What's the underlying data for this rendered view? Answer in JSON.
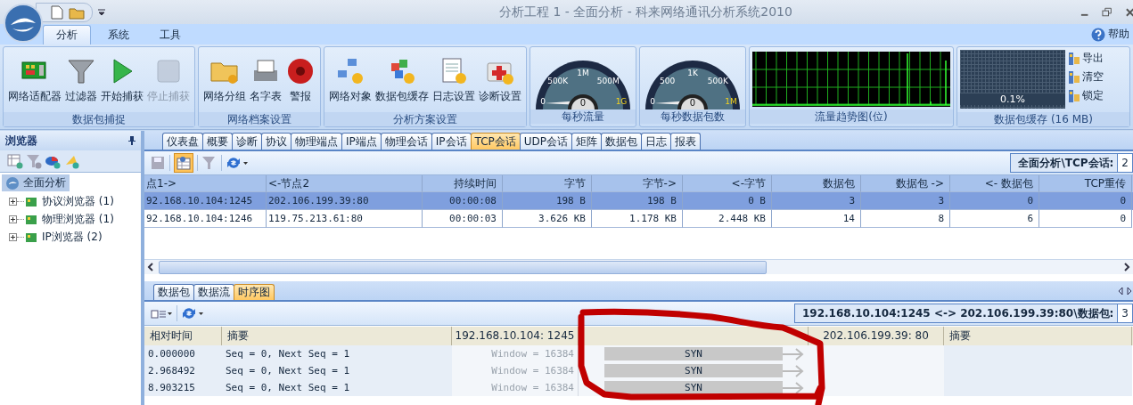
{
  "window": {
    "title": "分析工程 1 - 全面分析 - 科来网络通讯分析系统2010",
    "help": "帮助"
  },
  "ribbon_tabs": [
    {
      "label": "分析",
      "selected": true
    },
    {
      "label": "系统",
      "selected": false
    },
    {
      "label": "工具",
      "selected": false
    }
  ],
  "ribbon_groups": [
    {
      "label": "数据包捕捉",
      "buttons": [
        {
          "label": "网络适配器",
          "kind": "adapter",
          "disabled": false
        },
        {
          "label": "过滤器",
          "kind": "filter",
          "disabled": false
        },
        {
          "label": "开始捕获",
          "kind": "play",
          "disabled": false
        },
        {
          "label": "停止捕获",
          "kind": "stop",
          "disabled": true
        }
      ]
    },
    {
      "label": "网络档案设置",
      "buttons": [
        {
          "label": "网络分组",
          "kind": "folder",
          "disabled": false
        },
        {
          "label": "名字表",
          "kind": "cards",
          "disabled": false
        },
        {
          "label": "警报",
          "kind": "alarm",
          "disabled": false
        }
      ]
    },
    {
      "label": "分析方案设置",
      "buttons": [
        {
          "label": "网络对象",
          "kind": "network",
          "disabled": false
        },
        {
          "label": "数据包缓存",
          "kind": "cubes",
          "disabled": false
        },
        {
          "label": "日志设置",
          "kind": "log",
          "disabled": false
        },
        {
          "label": "诊断设置",
          "kind": "medkit",
          "disabled": false
        }
      ]
    }
  ],
  "gauges": [
    {
      "label": "每秒流量",
      "ticks": [
        "0",
        "500K",
        "1M",
        "500M",
        "1G"
      ],
      "reading": "0"
    },
    {
      "label": "每秒数据包数",
      "ticks": [
        "0",
        "500",
        "1K",
        "500K",
        "1M"
      ],
      "reading": "0"
    }
  ],
  "trend": {
    "label": "流量趋势图(位)"
  },
  "buffer": {
    "label": "数据包缓存 (16 MB)",
    "reading": "0.1%",
    "actions": [
      "导出",
      "清空",
      "锁定"
    ]
  },
  "sidebar": {
    "title": "浏览器",
    "tree": [
      {
        "label": "全面分析",
        "selected": true,
        "children": [
          {
            "label": "协议浏览器",
            "count": "(1)",
            "expanded": false
          },
          {
            "label": "物理浏览器",
            "count": "(1)",
            "expanded": false
          },
          {
            "label": "IP浏览器",
            "count": "(2)",
            "expanded": false
          }
        ]
      }
    ]
  },
  "tabs": [
    {
      "label": "仪表盘",
      "selected": false
    },
    {
      "label": "概要",
      "selected": false
    },
    {
      "label": "诊断",
      "selected": false
    },
    {
      "label": "协议",
      "selected": false
    },
    {
      "label": "物理端点",
      "selected": false
    },
    {
      "label": "IP端点",
      "selected": false
    },
    {
      "label": "物理会话",
      "selected": false
    },
    {
      "label": "IP会话",
      "selected": false
    },
    {
      "label": "TCP会话",
      "selected": true
    },
    {
      "label": "UDP会话",
      "selected": false
    },
    {
      "label": "矩阵",
      "selected": false
    },
    {
      "label": "数据包",
      "selected": false
    },
    {
      "label": "日志",
      "selected": false
    },
    {
      "label": "报表",
      "selected": false
    }
  ],
  "path": {
    "label": "全面分析\\TCP会话:",
    "value": "2"
  },
  "table": {
    "columns": [
      "点1->",
      "<-节点2",
      "持续时间",
      "字节",
      "字节->",
      "<-字节",
      "数据包",
      "数据包 ->",
      "<- 数据包",
      "TCP重传"
    ],
    "rows": [
      {
        "selected": true,
        "cells": [
          "92.168.10.104:1245",
          "202.106.199.39:80",
          "00:00:08",
          "198  B",
          "198  B",
          "0  B",
          "3",
          "3",
          "0",
          "0"
        ]
      },
      {
        "selected": false,
        "cells": [
          "92.168.10.104:1246",
          "119.75.213.61:80",
          "00:00:03",
          "3.626 KB",
          "1.178 KB",
          "2.448 KB",
          "14",
          "8",
          "6",
          "0"
        ]
      }
    ]
  },
  "bottom_tabs": [
    {
      "label": "数据包",
      "selected": false
    },
    {
      "label": "数据流",
      "selected": false
    },
    {
      "label": "时序图",
      "selected": true
    }
  ],
  "sequence": {
    "path": {
      "label": "192.168.10.104:1245 <-> 202.106.199.39:80\\数据包:",
      "value": "3"
    },
    "columns": [
      "相对时间",
      "摘要",
      "192.168.10.104: 1245",
      "202.106.199.39: 80",
      "摘要"
    ],
    "rows": [
      {
        "time": "0.000000",
        "summary": "Seq = 0, Next Seq = 1",
        "window": "Window = 16384",
        "flag": "SYN"
      },
      {
        "time": "2.968492",
        "summary": "Seq = 0, Next Seq = 1",
        "window": "Window = 16384",
        "flag": "SYN"
      },
      {
        "time": "8.903215",
        "summary": "Seq = 0, Next Seq = 1",
        "window": "Window = 16384",
        "flag": "SYN"
      }
    ]
  }
}
